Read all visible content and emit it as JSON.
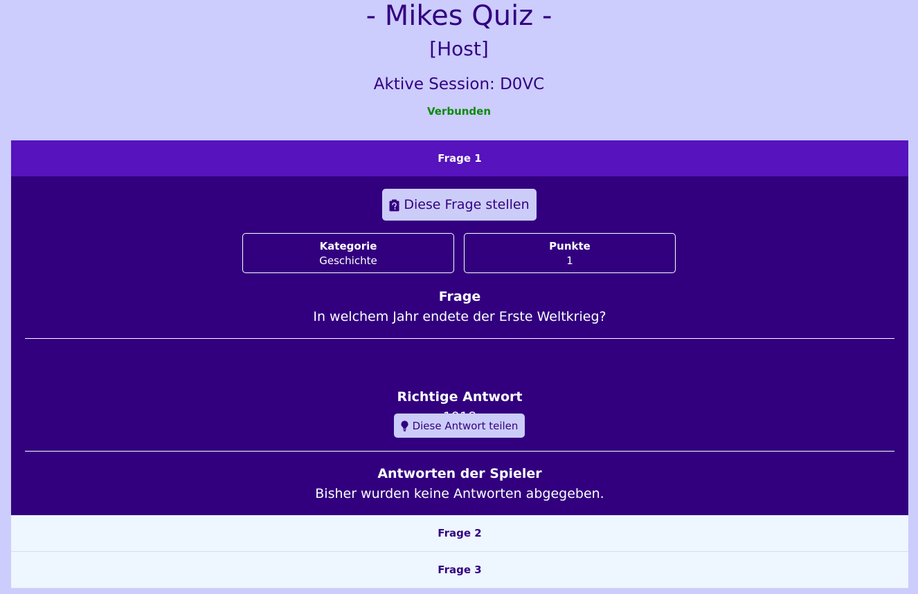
{
  "header": {
    "title": "- Mikes Quiz -",
    "role": "[Host]",
    "session": "Aktive Session: D0VC",
    "status": "Verbunden"
  },
  "colors": {
    "page_bg": "#ccccfd",
    "active_header_bg": "#5613be",
    "body_bg": "#32007f",
    "collapsed_header_bg": "#eef6ff",
    "button_bg": "#ccccf8",
    "status_green": "#0a8a0a",
    "text_dark": "#330080"
  },
  "questions": [
    {
      "header": "Frage 1",
      "expanded": true,
      "ask_button": {
        "label": "Diese Frage stellen",
        "icon": "clipboard-question-icon"
      },
      "category": {
        "label": "Kategorie",
        "value": "Geschichte"
      },
      "points": {
        "label": "Punkte",
        "value": "1"
      },
      "question": {
        "label": "Frage",
        "text": "In welchem Jahr endete der Erste Weltkrieg?"
      },
      "answer": {
        "label": "Richtige Antwort",
        "text": "1918"
      },
      "share_button": {
        "label": "Diese Antwort teilen",
        "icon": "lightbulb-icon"
      },
      "player_answers": {
        "label": "Antworten der Spieler",
        "text": "Bisher wurden keine Antworten abgegeben."
      }
    },
    {
      "header": "Frage 2",
      "expanded": false
    },
    {
      "header": "Frage 3",
      "expanded": false
    }
  ]
}
